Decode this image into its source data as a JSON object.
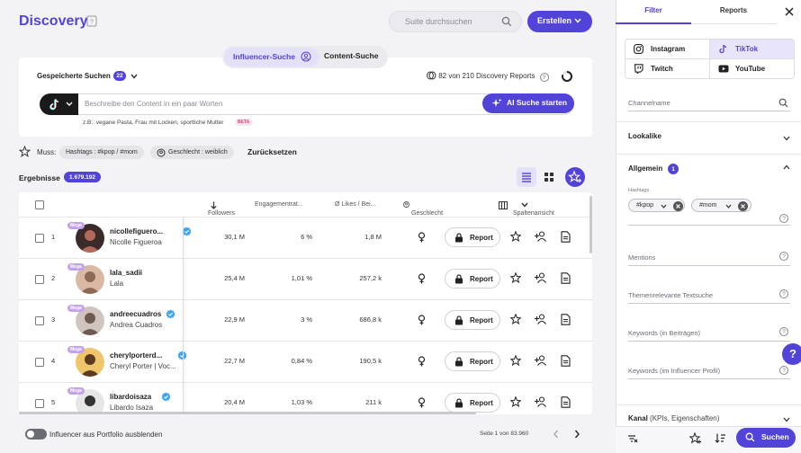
{
  "header": {
    "title": "Discovery",
    "search_placeholder": "Suite durchsuchen",
    "create_label": "Erstellen"
  },
  "search_tabs": {
    "influencer": "Influencer-Suche",
    "content": "Content-Suche"
  },
  "saved_searches": {
    "label": "Gespeicherte Suchen",
    "count": "22",
    "reports_used": "82 von 210 Discovery Reports"
  },
  "ai_search": {
    "placeholder": "Beschreibe den Content in ein paar Worten",
    "button": "AI Suche starten",
    "example": "z.B.: vegane Pasta, Frau mit Locken, sportliche Mutter",
    "beta": "BETA"
  },
  "filters": {
    "must_label": "Muss:",
    "chips": [
      "Hashtags : #kpop / #mom",
      "Geschlecht : weiblich"
    ],
    "reset": "Zurücksetzen"
  },
  "results": {
    "label": "Ergebnisse",
    "count": "1.679.192"
  },
  "table": {
    "columns": {
      "followers": "Followers",
      "engagement": "Engagementrat...",
      "likes": "Ø Likes / Bei...",
      "gender": "Geschlecht",
      "columns_view": "Spaltenansicht"
    },
    "report_label": "Report",
    "tier_badge": "Mega",
    "rows": [
      {
        "rank": "1",
        "username": "nicollefiguero...",
        "name": "Nicolle Figueroa",
        "followers": "30,1 M",
        "engagement": "6 %",
        "likes": "1,8 M",
        "verified": true
      },
      {
        "rank": "2",
        "username": "lala_sadii",
        "name": "Lala",
        "followers": "25,4 M",
        "engagement": "1,01 %",
        "likes": "257,2 k",
        "verified": false
      },
      {
        "rank": "3",
        "username": "andreecuadros",
        "name": "Andrea Cuadros",
        "followers": "22,9 M",
        "engagement": "3 %",
        "likes": "686,8 k",
        "verified": true
      },
      {
        "rank": "4",
        "username": "cherylporterd...",
        "name": "Cheryl Porter | Voc...",
        "followers": "22,7 M",
        "engagement": "0,84 %",
        "likes": "190,5 k",
        "verified": true
      },
      {
        "rank": "5",
        "username": "libardoisaza",
        "name": "Libardo Isaza",
        "followers": "20,4 M",
        "engagement": "1,03 %",
        "likes": "211 k",
        "verified": true
      }
    ]
  },
  "footer": {
    "hide_portfolio": "Influencer aus Portfolio ausblenden",
    "page": "Seite 1 von 83.960"
  },
  "panel": {
    "tab_filter": "Filter",
    "tab_reports": "Reports",
    "platforms": [
      "Instagram",
      "TikTok",
      "Twitch",
      "YouTube"
    ],
    "channelname_placeholder": "Channelname",
    "lookalike": "Lookalike",
    "allgemein": "Allgemein",
    "allgemein_count": "1",
    "hashtags_label": "Hashtags",
    "hashtags": [
      "#kpop",
      "#mom"
    ],
    "mentions": "Mentions",
    "themen": "Themenrelevante Textsuche",
    "keywords_posts": "Keywords (in Beiträgen)",
    "keywords_profile": "Keywords (im Influencer Profil)",
    "kanal": "Kanal",
    "kanal_sub": "(KPIs, Eigenschaften)",
    "help": "?",
    "search_button": "Suchen"
  },
  "colors": {
    "accent": "#5243d9",
    "verified": "#3ea6f2",
    "mega": "#c4a2e8"
  }
}
